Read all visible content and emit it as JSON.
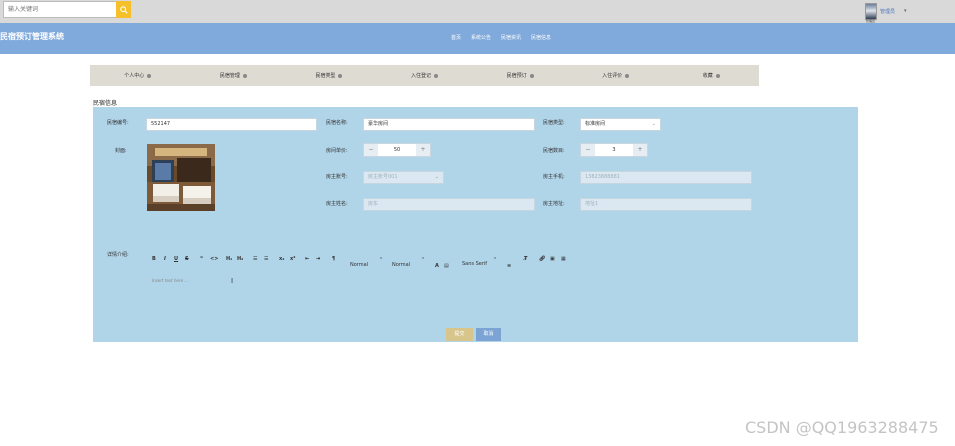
{
  "topbar": {
    "search_placeholder": "输入关键词",
    "username": "管理员",
    "avatar_caption": "管理员"
  },
  "header": {
    "title": "民宿预订管理系统",
    "nav": [
      "首页",
      "系统公告",
      "民宿资讯",
      "民宿信息"
    ]
  },
  "subnav": {
    "items": [
      "个人中心",
      "民宿管理",
      "民宿类型",
      "入住登记",
      "民宿预订",
      "入住评价",
      "收藏"
    ]
  },
  "form": {
    "section_title": "民宿信息",
    "labels": {
      "code": "民宿编号:",
      "name": "民宿名称:",
      "type": "民宿类型:",
      "cover": "封面:",
      "price": "房间单价:",
      "days": "民宿数目:",
      "owner_account": "房主账号:",
      "owner_phone": "房主手机:",
      "owner_name": "房主姓名:",
      "owner_address": "房主地址:",
      "description": "详情介绍:"
    },
    "values": {
      "code": "552147",
      "name": "豪华房间",
      "type": "标准房间",
      "price": "50",
      "days": "3",
      "owner_account": "房主账号001",
      "owner_phone": "13823888881",
      "owner_name": "房东",
      "owner_address": "地址1"
    },
    "editor": {
      "placeholder": "Insert text here ...",
      "header_select": "Normal",
      "size_select": "Normal",
      "font_select": "Sans Serif"
    },
    "submit_label": "提交",
    "cancel_label": "取消"
  },
  "watermark": "CSDN @QQ1963288475"
}
